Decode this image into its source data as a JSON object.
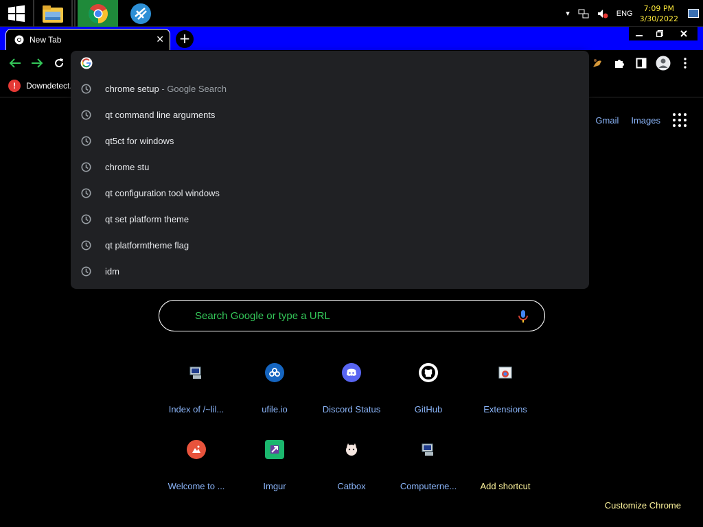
{
  "taskbar": {
    "clock_time": "7:09 PM",
    "clock_date": "3/30/2022",
    "language": "ENG"
  },
  "browser": {
    "tab_title": "New Tab",
    "bookmark": "Downdetect..."
  },
  "omnibox": {
    "suggestions": [
      {
        "text": "chrome setup",
        "suffix": " - Google Search"
      },
      {
        "text": "qt command line arguments",
        "suffix": ""
      },
      {
        "text": "qt5ct for windows",
        "suffix": ""
      },
      {
        "text": "chrome stu",
        "suffix": ""
      },
      {
        "text": "qt configuration tool windows",
        "suffix": ""
      },
      {
        "text": "qt set platform theme",
        "suffix": ""
      },
      {
        "text": "qt platformtheme flag",
        "suffix": ""
      },
      {
        "text": "idm",
        "suffix": ""
      }
    ]
  },
  "ntp": {
    "gmail": "Gmail",
    "images": "Images",
    "search_placeholder": "Search Google or type a URL",
    "shortcuts": [
      {
        "label": "Index of /~lil...",
        "icon": "computer-icon"
      },
      {
        "label": "ufile.io",
        "icon": "ufile-icon"
      },
      {
        "label": "Discord Status",
        "icon": "discord-icon"
      },
      {
        "label": "GitHub",
        "icon": "github-icon"
      },
      {
        "label": "Extensions",
        "icon": "extensions-icon"
      },
      {
        "label": "Welcome to ...",
        "icon": "welcome-icon"
      },
      {
        "label": "Imgur",
        "icon": "imgur-icon"
      },
      {
        "label": "Catbox",
        "icon": "catbox-icon"
      },
      {
        "label": "Computerne...",
        "icon": "computer-icon"
      },
      {
        "label": "Add shortcut",
        "icon": "add-icon"
      }
    ],
    "customize": "Customize Chrome"
  },
  "colors": {
    "tabstrip": "#0000ff",
    "accent_link": "#8ab4f8",
    "placeholder_green": "#34c759",
    "yellow": "#fff59d"
  }
}
